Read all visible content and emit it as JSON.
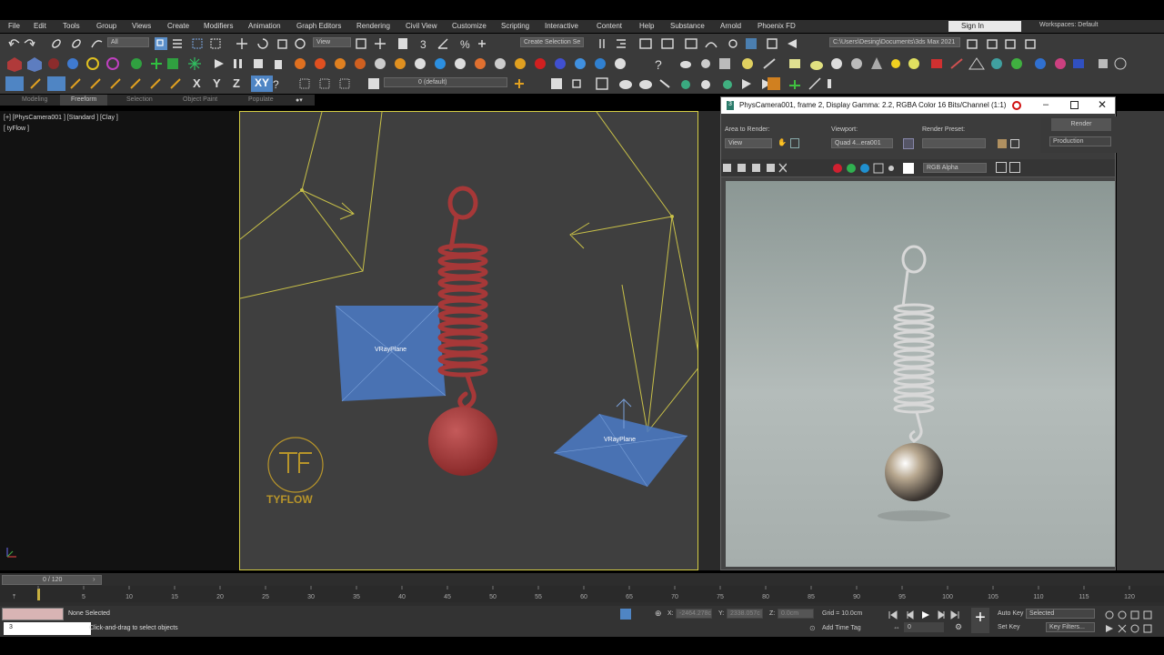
{
  "menu": [
    "File",
    "Edit",
    "Tools",
    "Group",
    "Views",
    "Create",
    "Modifiers",
    "Animation",
    "Graph Editors",
    "Rendering",
    "Civil View",
    "Customize",
    "Scripting",
    "Interactive",
    "Content",
    "Help",
    "Substance",
    "Arnold",
    "Phoenix FD"
  ],
  "account": {
    "signin": "Sign In",
    "workspaces_label": "Workspaces: Default"
  },
  "toolbar": {
    "selection_filter": "All",
    "ref_coord": "View",
    "selection_set": "Create Selection Se",
    "project_path": "C:\\Users\\Desing\\Documents\\3ds Max 2021",
    "layer": "0 (default)"
  },
  "axis_buttons": [
    "X",
    "Y",
    "Z",
    "XY"
  ],
  "ribbon_tabs": [
    "Modeling",
    "Freeform",
    "Selection",
    "Object Paint",
    "Populate"
  ],
  "viewport": {
    "label": "[+] [PhysCamera001 ] [Standard ] [Clay ]",
    "label2": "[ tyFlow ]",
    "plane1": "VRayPlane",
    "plane2": "VRayPlane",
    "logo": "TYFLOW"
  },
  "render_window": {
    "title": "PhysCamera001, frame 2, Display Gamma: 2.2, RGBA Color 16 Bits/Channel (1:1)",
    "area_label": "Area to Render:",
    "area_value": "View",
    "viewport_label": "Viewport:",
    "viewport_value": "Quad 4...era001",
    "preset_label": "Render Preset:",
    "preset_value": "",
    "render_button": "Render",
    "production": "Production",
    "channel": "RGB Alpha"
  },
  "timeline": {
    "frame": "0 / 120",
    "ticks": [
      "0",
      "5",
      "10",
      "15",
      "20",
      "25",
      "30",
      "35",
      "40",
      "45",
      "50",
      "55",
      "60",
      "65",
      "70",
      "75",
      "80",
      "85",
      "90",
      "95",
      "100",
      "105",
      "110",
      "115",
      "120"
    ]
  },
  "status": {
    "selected": "None Selected",
    "hint": "Click-and-drag to select objects",
    "x_label": "X:",
    "x_value": "-2464.278c",
    "y_label": "Y:",
    "y_value": "2338.057c",
    "z_label": "Z:",
    "z_value": "0.0cm",
    "grid": "Grid = 10.0cm",
    "add_time_tag": "Add Time Tag",
    "auto_key": "Auto Key",
    "auto_key_value": "Selected",
    "set_key": "Set Key",
    "key_filters": "Key Filters...",
    "current_frame": "0"
  }
}
